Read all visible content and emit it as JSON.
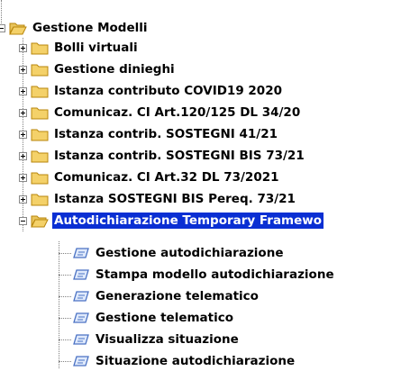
{
  "tree": {
    "root": {
      "label": "Gestione Modelli",
      "expanded": true
    },
    "groups": [
      {
        "label": "Bolli virtuali",
        "expanded": false
      },
      {
        "label": "Gestione dinieghi",
        "expanded": false
      },
      {
        "label": "Istanza contributo COVID19 2020",
        "expanded": false
      },
      {
        "label": "Comunicaz. CI Art.120/125 DL 34/20",
        "expanded": false
      },
      {
        "label": "Istanza contrib. SOSTEGNI 41/21",
        "expanded": false
      },
      {
        "label": "Istanza contrib. SOSTEGNI BIS 73/21",
        "expanded": false
      },
      {
        "label": "Comunicaz. CI Art.32 DL 73/2021",
        "expanded": false
      },
      {
        "label": "Istanza SOSTEGNI BIS Pereq. 73/21",
        "expanded": false
      },
      {
        "label": "Autodichiarazione Temporary Framewo",
        "expanded": true,
        "selected": true
      }
    ],
    "children": [
      {
        "label": "Gestione autodichiarazione"
      },
      {
        "label": "Stampa modello autodichiarazione"
      },
      {
        "label": "Generazione telematico"
      },
      {
        "label": "Gestione telematico"
      },
      {
        "label": "Visualizza situazione"
      },
      {
        "label": "Situazione autodichiarazione"
      }
    ]
  },
  "colors": {
    "selection": "#0a2fd3",
    "folder": "#f4d169",
    "folder_edge": "#b8860b",
    "doc": "#4a72c4"
  }
}
